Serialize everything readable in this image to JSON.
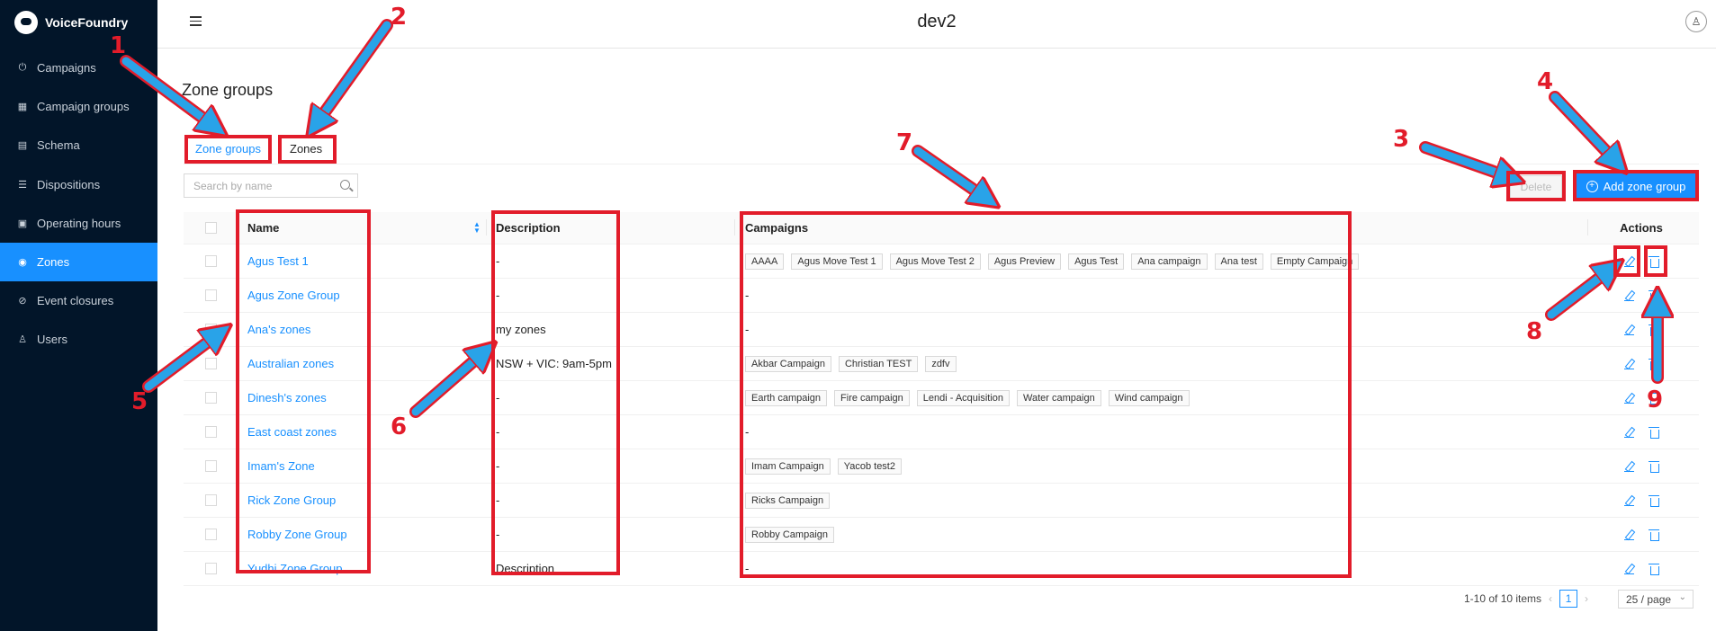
{
  "app": {
    "name": "VoiceFoundry"
  },
  "sidebar": {
    "items": [
      {
        "label": "Campaigns",
        "icon": "power-icon"
      },
      {
        "label": "Campaign groups",
        "icon": "grid-icon"
      },
      {
        "label": "Schema",
        "icon": "table-icon"
      },
      {
        "label": "Dispositions",
        "icon": "list-icon"
      },
      {
        "label": "Operating hours",
        "icon": "calendar-icon"
      },
      {
        "label": "Zones",
        "icon": "location-icon",
        "active": true
      },
      {
        "label": "Event closures",
        "icon": "stop-icon"
      },
      {
        "label": "Users",
        "icon": "user-icon"
      }
    ]
  },
  "header": {
    "title": "dev2"
  },
  "page": {
    "title": "Zone groups",
    "tabs": [
      {
        "label": "Zone groups",
        "active": true
      },
      {
        "label": "Zones"
      }
    ],
    "search_placeholder": "Search by name",
    "delete_label": "Delete",
    "add_label": "Add zone group"
  },
  "table": {
    "headers": {
      "name": "Name",
      "description": "Description",
      "campaigns": "Campaigns",
      "actions": "Actions"
    },
    "rows": [
      {
        "name": "Agus Test 1",
        "description": "-",
        "campaigns": [
          "AAAA",
          "Agus Move Test 1",
          "Agus Move Test 2",
          "Agus Preview",
          "Agus Test",
          "Ana campaign",
          "Ana test",
          "Empty Campaign"
        ]
      },
      {
        "name": "Agus Zone Group",
        "description": "-",
        "campaigns_text": "-"
      },
      {
        "name": "Ana's zones",
        "description": "my zones",
        "campaigns_text": "-"
      },
      {
        "name": "Australian zones",
        "description": "NSW + VIC: 9am-5pm",
        "campaigns": [
          "Akbar Campaign",
          "Christian TEST",
          "zdfv"
        ]
      },
      {
        "name": "Dinesh's zones",
        "description": "-",
        "campaigns": [
          "Earth campaign",
          "Fire campaign",
          "Lendi - Acquisition",
          "Water campaign",
          "Wind campaign"
        ]
      },
      {
        "name": "East coast zones",
        "description": "-",
        "campaigns_text": "-"
      },
      {
        "name": "Imam's Zone",
        "description": "-",
        "campaigns": [
          "Imam Campaign",
          "Yacob test2"
        ]
      },
      {
        "name": "Rick Zone Group",
        "description": "-",
        "campaigns": [
          "Ricks Campaign"
        ]
      },
      {
        "name": "Robby Zone Group",
        "description": "-",
        "campaigns": [
          "Robby Campaign"
        ]
      },
      {
        "name": "Yudhi Zone Group",
        "description": "Description",
        "campaigns_text": "-"
      }
    ]
  },
  "pagination": {
    "summary": "1-10 of 10 items",
    "current_page": "1",
    "page_size": "25 / page"
  },
  "annotations": {
    "color": "#e21c2a",
    "arrow_color": "#29a3e8",
    "labels": [
      "1",
      "2",
      "3",
      "4",
      "5",
      "6",
      "7",
      "8",
      "9"
    ]
  }
}
